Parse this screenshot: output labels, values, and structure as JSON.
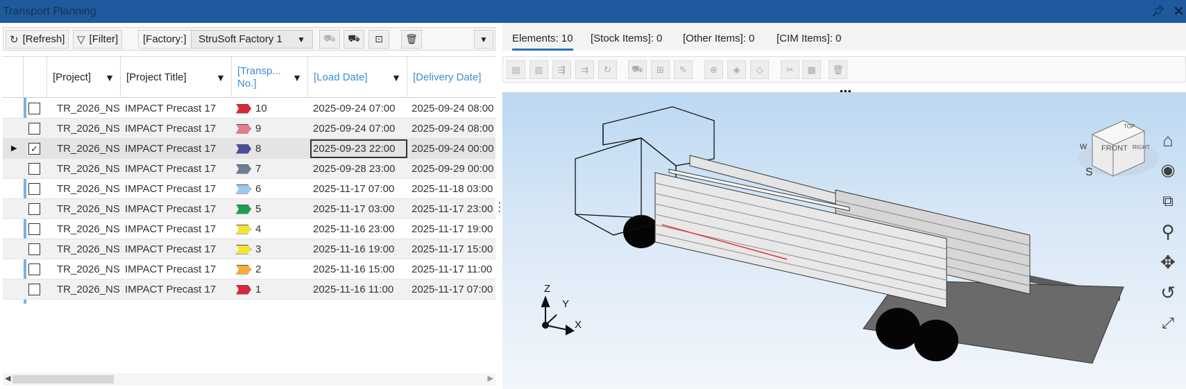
{
  "window": {
    "title": "Transport Planning",
    "pin_icon": "pin-icon",
    "close_icon": "close-icon"
  },
  "toolbar": {
    "refresh_label": "[Refresh]",
    "filter_label": "[Filter]",
    "factory_label": "[Factory:]",
    "factory_value": "StruSoft Factory 1"
  },
  "grid": {
    "headers": {
      "project": "[Project]",
      "project_title": "[Project Title]",
      "transport_no_line1": "[Transp...",
      "transport_no_line2": "No.]",
      "load_date": "[Load Date]",
      "delivery_date": "[Delivery Date]"
    },
    "rows": [
      {
        "checked": false,
        "project": "TR_2026_NS",
        "title": "IMPACT Precast 17",
        "no": "10",
        "flag_color": "#d8283a",
        "load": "2025-09-24 07:00",
        "delivery": "2025-09-24 08:00"
      },
      {
        "checked": false,
        "project": "TR_2026_NS",
        "title": "IMPACT Precast 17",
        "no": "9",
        "flag_color": "#e87a8e",
        "load": "2025-09-24 07:00",
        "delivery": "2025-09-24 08:00"
      },
      {
        "checked": true,
        "project": "TR_2026_NS",
        "title": "IMPACT Precast 17",
        "no": "8",
        "flag_color": "#4b4aa0",
        "load": "2025-09-23 22:00",
        "delivery": "2025-09-24 00:00",
        "selected": true
      },
      {
        "checked": false,
        "project": "TR_2026_NS",
        "title": "IMPACT Precast 17",
        "no": "7",
        "flag_color": "#6e7f95",
        "load": "2025-09-28 23:00",
        "delivery": "2025-09-29 00:00"
      },
      {
        "checked": false,
        "project": "TR_2026_NS",
        "title": "IMPACT Precast 17",
        "no": "6",
        "flag_color": "#9cc7ef",
        "load": "2025-11-17 07:00",
        "delivery": "2025-11-18 03:00"
      },
      {
        "checked": false,
        "project": "TR_2026_NS",
        "title": "IMPACT Precast 17",
        "no": "5",
        "flag_color": "#1f9e4a",
        "load": "2025-11-17 03:00",
        "delivery": "2025-11-17 23:00"
      },
      {
        "checked": false,
        "project": "TR_2026_NS",
        "title": "IMPACT Precast 17",
        "no": "4",
        "flag_color": "#f2e436",
        "load": "2025-11-16 23:00",
        "delivery": "2025-11-17 19:00"
      },
      {
        "checked": false,
        "project": "TR_2026_NS",
        "title": "IMPACT Precast 17",
        "no": "3",
        "flag_color": "#f2e436",
        "load": "2025-11-16 19:00",
        "delivery": "2025-11-17 15:00"
      },
      {
        "checked": false,
        "project": "TR_2026_NS",
        "title": "IMPACT Precast 17",
        "no": "2",
        "flag_color": "#f5ad36",
        "load": "2025-11-16 15:00",
        "delivery": "2025-11-17 11:00"
      },
      {
        "checked": false,
        "project": "TR_2026_NS",
        "title": "IMPACT Precast 17",
        "no": "1",
        "flag_color": "#d8283a",
        "load": "2025-11-16 11:00",
        "delivery": "2025-11-17 07:00"
      }
    ]
  },
  "right_tabs": {
    "elements": "Elements: 10",
    "stock_items": "[Stock Items]: 0",
    "other_items": "[Other Items]: 0",
    "cim_items": "[CIM Items]: 0"
  },
  "viewer": {
    "viewcube_front": "FRONT",
    "viewcube_top": "TOP",
    "viewcube_right": "RIGHT",
    "compass_w": "W",
    "compass_s": "S",
    "axis_x": "X",
    "axis_y": "Y",
    "axis_z": "Z",
    "nav_icons": [
      "home-icon",
      "orbit-icon",
      "zoom-window-icon",
      "zoom-icon",
      "pan-icon",
      "rotate-icon",
      "fit-all-icon"
    ]
  }
}
